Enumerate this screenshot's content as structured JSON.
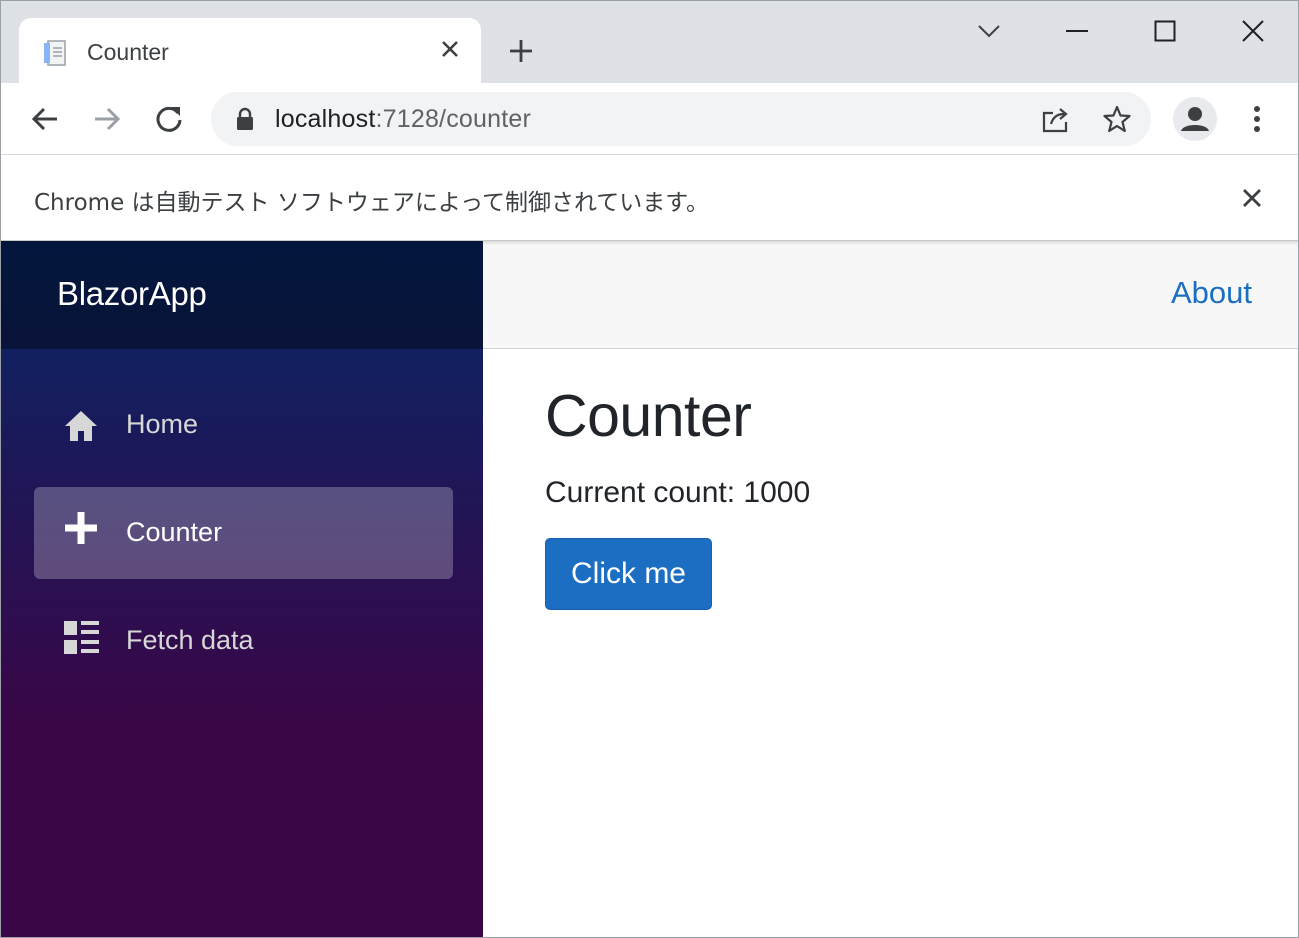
{
  "browser": {
    "tab": {
      "title": "Counter"
    },
    "address_bar": {
      "host": "localhost",
      "path": ":7128/counter"
    },
    "infobar": {
      "message": "Chrome は自動テスト ソフトウェアによって制御されています。"
    }
  },
  "app": {
    "brand": "BlazorApp",
    "nav": [
      {
        "label": "Home",
        "icon": "home-icon",
        "active": false
      },
      {
        "label": "Counter",
        "icon": "plus-icon",
        "active": true
      },
      {
        "label": "Fetch data",
        "icon": "list-rich-icon",
        "active": false
      }
    ],
    "top_row": {
      "about_label": "About"
    },
    "page": {
      "title": "Counter",
      "count_label": "Current count: 1000",
      "button_label": "Click me"
    }
  },
  "colors": {
    "accent": "#1b6ec2",
    "sidebar_top": "#052767",
    "sidebar_bottom": "#3a0647",
    "tabstrip": "#dee1e6"
  }
}
